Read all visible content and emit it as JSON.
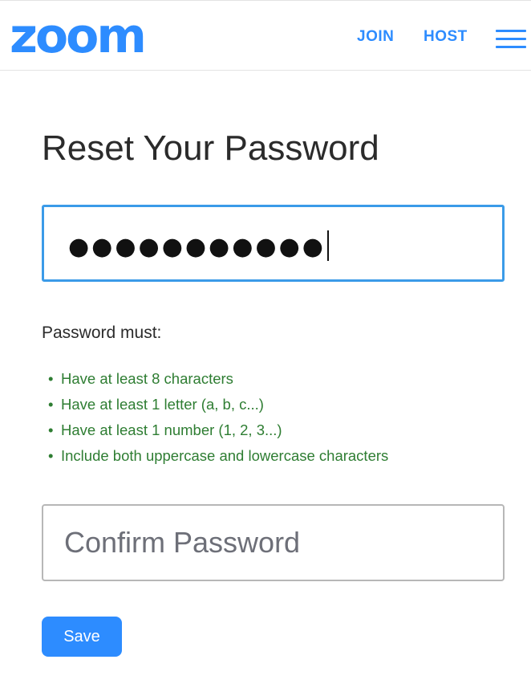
{
  "colors": {
    "brand": "#2D8CFF",
    "focus": "#3B9BE8",
    "rule_ok": "#2E7D32"
  },
  "header": {
    "logo_text": "zoom",
    "nav": {
      "join_label": "JOIN",
      "host_label": "HOST"
    },
    "menu_icon": "hamburger-menu-icon"
  },
  "main": {
    "title": "Reset Your Password",
    "password_field": {
      "value_masked": "●●●●●●●●●●●"
    },
    "requirements": {
      "heading": "Password must:",
      "items": [
        "Have at least 8 characters",
        "Have at least 1 letter (a, b, c...)",
        "Have at least 1 number (1, 2, 3...)",
        "Include both uppercase and lowercase characters"
      ]
    },
    "confirm_field": {
      "placeholder": "Confirm Password",
      "value": ""
    },
    "save_label": "Save"
  }
}
